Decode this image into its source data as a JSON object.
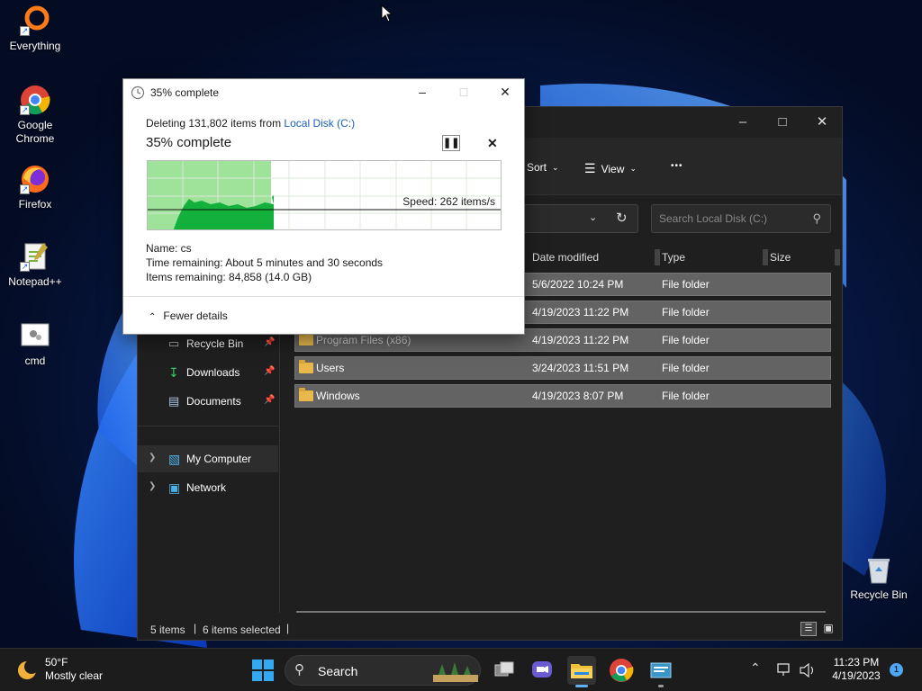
{
  "desktop": {
    "icons": [
      {
        "label": "Everything"
      },
      {
        "label": "Google Chrome"
      },
      {
        "label": "Firefox"
      },
      {
        "label": "Notepad++"
      },
      {
        "label": "cmd"
      }
    ],
    "recycle_bin": "Recycle Bin"
  },
  "dialog": {
    "title": "35% complete",
    "line1_prefix": "Deleting 131,802 items from ",
    "line1_link": "Local Disk (C:)",
    "heading": "35% complete",
    "progress": 0.35,
    "speed": "Speed: 262 items/s",
    "name_label": "Name:  cs",
    "time_label": "Time remaining:  About 5 minutes and 30 seconds",
    "items_label": "Items remaining:  84,858 (14.0 GB)",
    "fewer_details": "Fewer details"
  },
  "explorer": {
    "toolbar": {
      "sort": "Sort",
      "view": "View",
      "more": "•••"
    },
    "search_placeholder": "Search Local Disk (C:)",
    "columns": {
      "date": "Date modified",
      "type": "Type",
      "size": "Size"
    },
    "rows": [
      {
        "name": "",
        "date": "5/6/2022 10:24 PM",
        "type": "File folder"
      },
      {
        "name": "",
        "date": "4/19/2023 11:22 PM",
        "type": "File folder"
      },
      {
        "name": "Program Files (x86)",
        "date": "4/19/2023 11:22 PM",
        "type": "File folder"
      },
      {
        "name": "Users",
        "date": "3/24/2023 11:51 PM",
        "type": "File folder"
      },
      {
        "name": "Windows",
        "date": "4/19/2023 8:07 PM",
        "type": "File folder"
      }
    ],
    "nav": [
      {
        "label": "Recycle Bin"
      },
      {
        "label": "Downloads"
      },
      {
        "label": "Documents"
      },
      {
        "label": "My Computer"
      },
      {
        "label": "Network"
      }
    ],
    "status": {
      "items": "5 items",
      "selected": "6 items selected"
    }
  },
  "taskbar": {
    "weather_temp": "50°F",
    "weather_desc": "Mostly clear",
    "search_label": "Search",
    "time": "11:23 PM",
    "date": "4/19/2023",
    "notification_count": "1"
  }
}
